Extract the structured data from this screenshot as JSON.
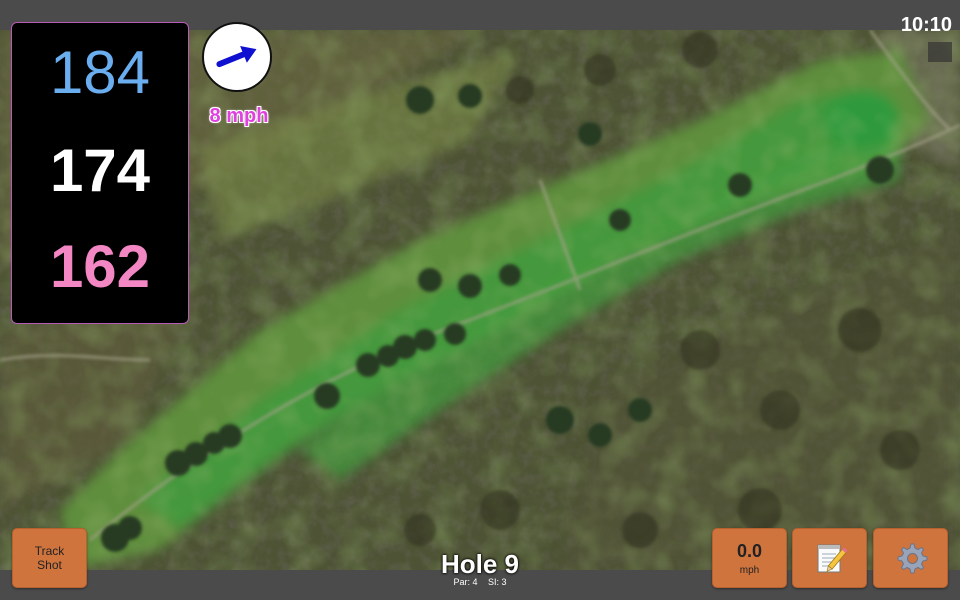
{
  "status_bar": {
    "time": "10:10"
  },
  "distances": {
    "back": "184",
    "middle": "174",
    "front": "162",
    "back_color": "#6aaef0",
    "middle_color": "#ffffff",
    "front_color": "#f287c4"
  },
  "wind": {
    "speed_text": "8 mph",
    "arrow_icon": "arrow-icon",
    "arrow_color": "#1010d0",
    "speed_color": "#e040e0"
  },
  "buttons": {
    "track_shot_line1": "Track",
    "track_shot_line2": "Shot",
    "speed_value": "0.0",
    "speed_unit": "mph",
    "notes_icon": "notepad-icon",
    "settings_icon": "gear-icon",
    "button_color": "#d0743e"
  },
  "hole": {
    "title": "Hole 9",
    "par": "Par: 4",
    "si": "SI: 3"
  }
}
